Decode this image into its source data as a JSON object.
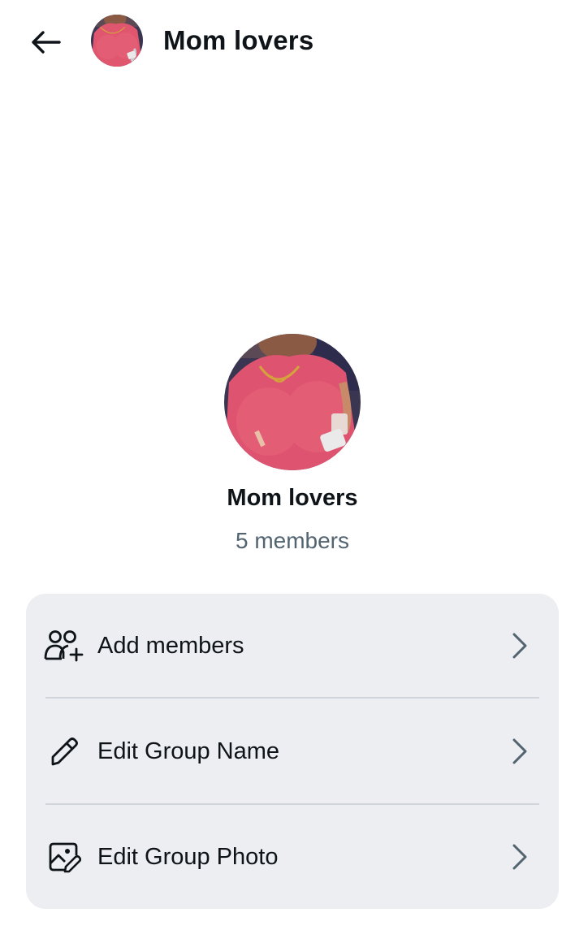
{
  "header": {
    "back_icon": "arrow-left-icon",
    "title": "Mom lovers"
  },
  "group": {
    "name": "Mom lovers",
    "members_text": "5 members"
  },
  "menu": {
    "items": [
      {
        "label": "Add members",
        "icon": "add-members-icon"
      },
      {
        "label": "Edit Group Name",
        "icon": "pencil-icon"
      },
      {
        "label": "Edit Group Photo",
        "icon": "edit-photo-icon"
      }
    ],
    "chevron_icon": "chevron-right-icon"
  },
  "colors": {
    "text_primary": "#0f1419",
    "text_secondary": "#536471",
    "card_bg": "#eceef1",
    "divider": "#cfd5da",
    "avatar_pink": "#d9546d"
  }
}
